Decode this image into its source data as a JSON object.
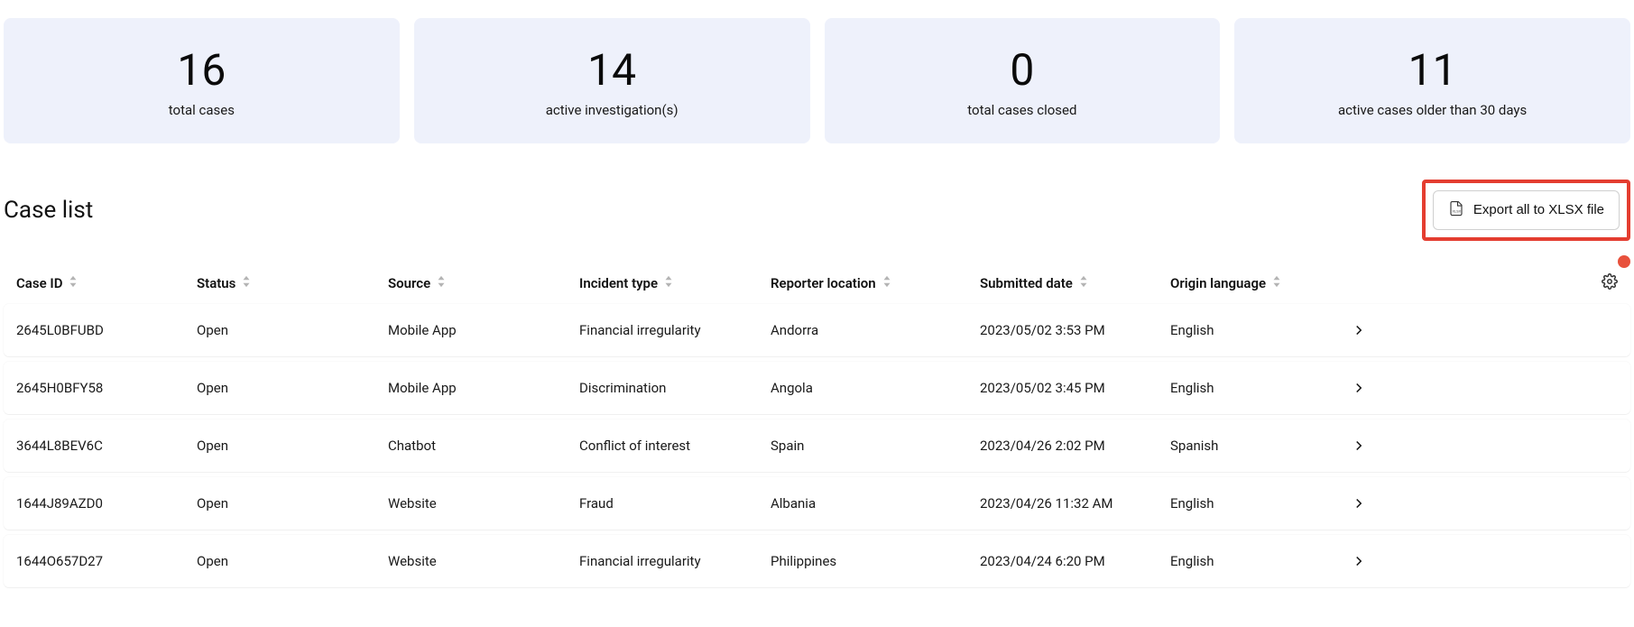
{
  "stats": [
    {
      "value": "16",
      "label": "total cases"
    },
    {
      "value": "14",
      "label": "active investigation(s)"
    },
    {
      "value": "0",
      "label": "total cases closed"
    },
    {
      "value": "11",
      "label": "active cases older than 30 days"
    }
  ],
  "list_title": "Case list",
  "export_label": "Export all to XLSX file",
  "headers": {
    "case_id": "Case ID",
    "status": "Status",
    "source": "Source",
    "incident": "Incident type",
    "location": "Reporter location",
    "date": "Submitted date",
    "lang": "Origin language"
  },
  "rows": [
    {
      "case_id": "2645L0BFUBD",
      "status": "Open",
      "source": "Mobile App",
      "incident": "Financial irregularity",
      "location": "Andorra",
      "date": "2023/05/02 3:53 PM",
      "lang": "English"
    },
    {
      "case_id": "2645H0BFY58",
      "status": "Open",
      "source": "Mobile App",
      "incident": "Discrimination",
      "location": "Angola",
      "date": "2023/05/02 3:45 PM",
      "lang": "English"
    },
    {
      "case_id": "3644L8BEV6C",
      "status": "Open",
      "source": "Chatbot",
      "incident": "Conflict of interest",
      "location": "Spain",
      "date": "2023/04/26 2:02 PM",
      "lang": "Spanish"
    },
    {
      "case_id": "1644J89AZD0",
      "status": "Open",
      "source": "Website",
      "incident": "Fraud",
      "location": "Albania",
      "date": "2023/04/26 11:32 AM",
      "lang": "English"
    },
    {
      "case_id": "1644O657D27",
      "status": "Open",
      "source": "Website",
      "incident": "Financial irregularity",
      "location": "Philippines",
      "date": "2023/04/24 6:20 PM",
      "lang": "English"
    }
  ]
}
